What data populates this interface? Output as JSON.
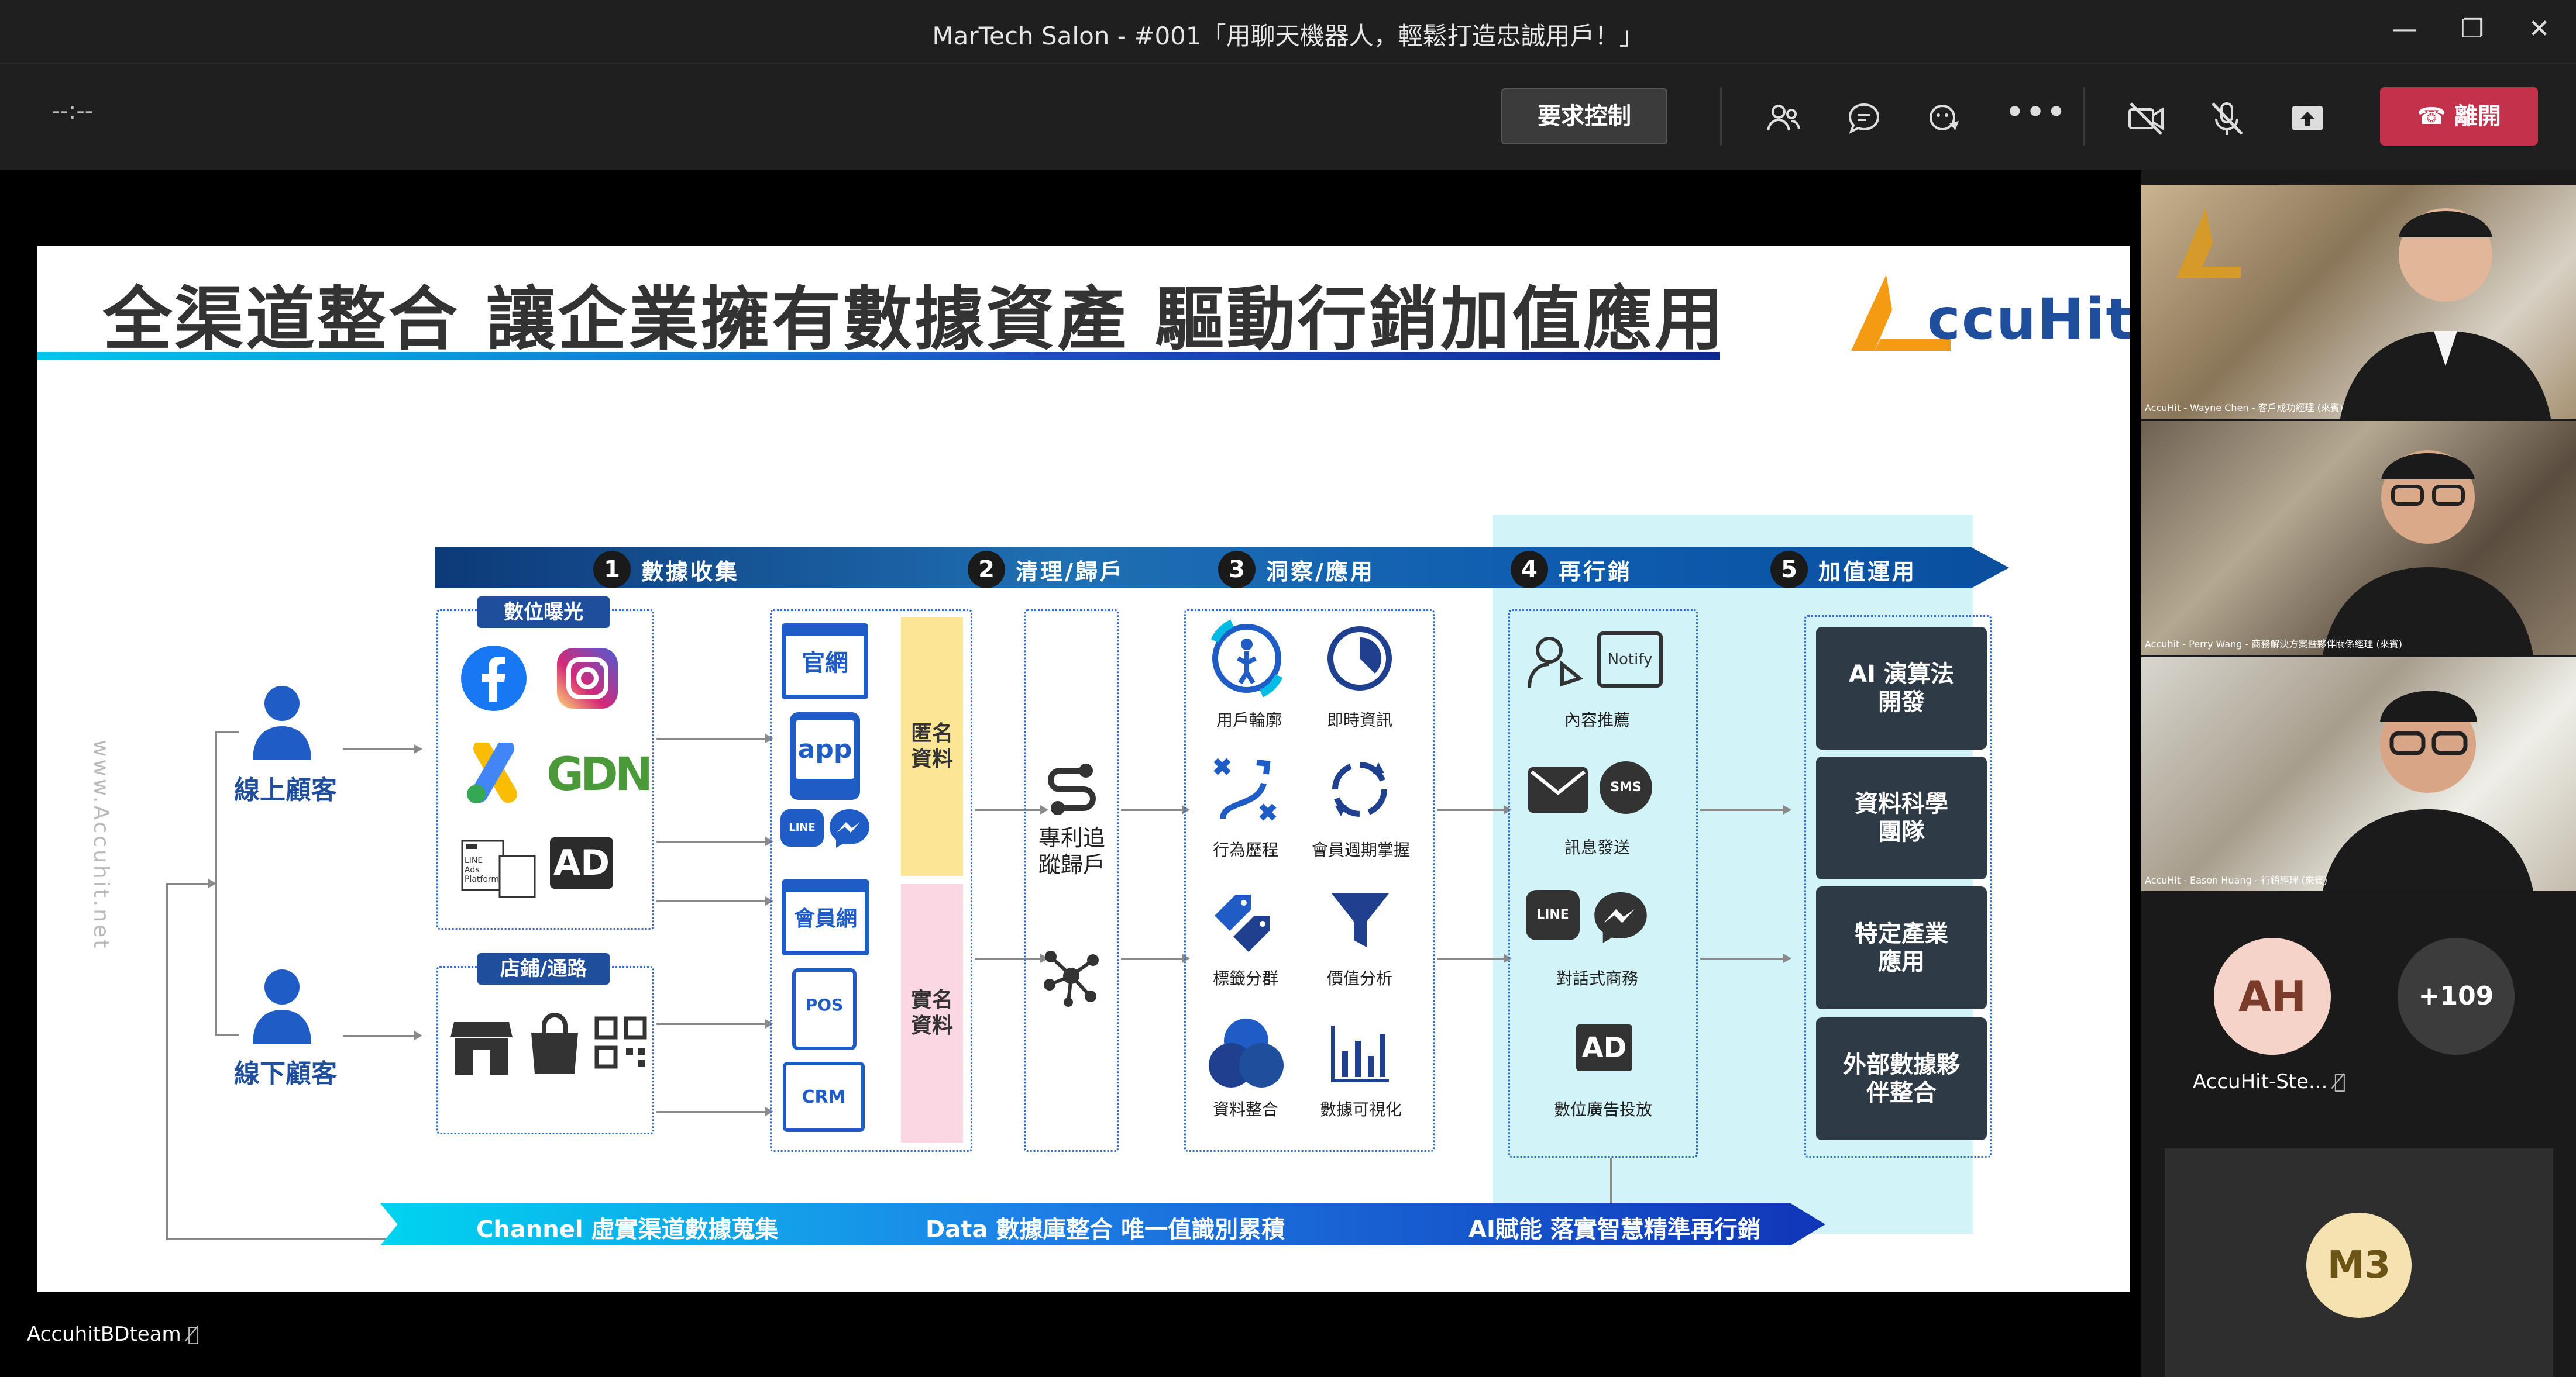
{
  "window": {
    "title": "MarTech Salon - #001「用聊天機器人，輕鬆打造忠誠用戶！」",
    "minimize_icon": "minimize-icon",
    "maximize_icon": "restore-icon",
    "close_icon": "close-icon"
  },
  "toolbar": {
    "timer": "--:--",
    "request_control": "要求控制",
    "leave": "離開",
    "icons": [
      "participants-icon",
      "chat-icon",
      "reactions-icon",
      "more-icon",
      "camera-off-icon",
      "mic-off-icon",
      "share-icon",
      "phone-icon"
    ],
    "leave_color": "#c4314b"
  },
  "slide": {
    "title": "全渠道整合 讓企業擁有數據資產  驅動行銷加值應用",
    "logo_text": "ccuHit",
    "watermark": "www.Accuhit.net",
    "steps": [
      {
        "num": "1",
        "label": "數據收集"
      },
      {
        "num": "2",
        "label": "清理/歸戶"
      },
      {
        "num": "3",
        "label": "洞察/應用"
      },
      {
        "num": "4",
        "label": "再行銷"
      },
      {
        "num": "5",
        "label": "加值運用"
      }
    ],
    "customers": {
      "online": "線上顧客",
      "offline": "線下顧客"
    },
    "digital": {
      "tag": "數位曝光",
      "line_ads_text": "LINE Ads Platform",
      "ad_text": "AD",
      "gdn_text": "GDN",
      "icons": [
        "facebook-icon",
        "instagram-icon",
        "google-ads-icon",
        "gdn-icon",
        "line-ads-icon",
        "ad-icon"
      ]
    },
    "store": {
      "tag": "店鋪/通路",
      "icons": [
        "store-icon",
        "shopping-bag-icon",
        "qr-code-icon"
      ]
    },
    "sources": {
      "website": "官網",
      "app": "app",
      "line": "LINE",
      "member": "會員網",
      "pos": "POS",
      "crm": "CRM",
      "anonymous": "匿名資料",
      "real_name": "實名資料"
    },
    "cleanse": {
      "label": "專利追蹤歸戶"
    },
    "insight": [
      {
        "label": "用戶輪廓",
        "icon": "user-profile-icon"
      },
      {
        "label": "即時資訊",
        "icon": "clock-icon"
      },
      {
        "label": "行為歷程",
        "icon": "journey-icon"
      },
      {
        "label": "會員週期掌握",
        "icon": "cycle-icon"
      },
      {
        "label": "標籤分群",
        "icon": "tags-icon"
      },
      {
        "label": "價值分析",
        "icon": "funnel-icon"
      },
      {
        "label": "資料整合",
        "icon": "merge-icon"
      },
      {
        "label": "數據可視化",
        "icon": "bar-chart-icon"
      }
    ],
    "remarketing": [
      {
        "label": "內容推薦",
        "icon": "recommend-icon"
      },
      {
        "label": "訊息發送",
        "icon": "message-icon"
      },
      {
        "label": "對話式商務",
        "icon": "chat-commerce-icon"
      },
      {
        "label": "數位廣告投放",
        "icon": "ad-icon"
      }
    ],
    "notify_text": "Notify",
    "sms_text": "SMS",
    "value_added": [
      "AI 演算法\n開發",
      "資料科學\n團隊",
      "特定產業\n應用",
      "外部數據夥\n伴整合"
    ],
    "bottom_band": [
      "Channel 虛實渠道數據蒐集",
      "Data 數據庫整合 唯一值識別累積",
      "AI賦能 落實智慧精準再行銷"
    ]
  },
  "presenter": "AccuhitBDteam",
  "participants": [
    {
      "caption": "AccuHit - Wayne Chen - 客戶成功經理 (來賓)"
    },
    {
      "caption": "Accuhit - Perry Wang - 商務解決方案暨夥伴關係經理 (來賓)"
    },
    {
      "caption": "AccuHit - Eason Huang - 行銷經理 (來賓)"
    }
  ],
  "roster": {
    "ah_initials": "AH",
    "ah_name": "AccuHit-Ste...",
    "more_count": "+109",
    "m3_initials": "M3"
  }
}
